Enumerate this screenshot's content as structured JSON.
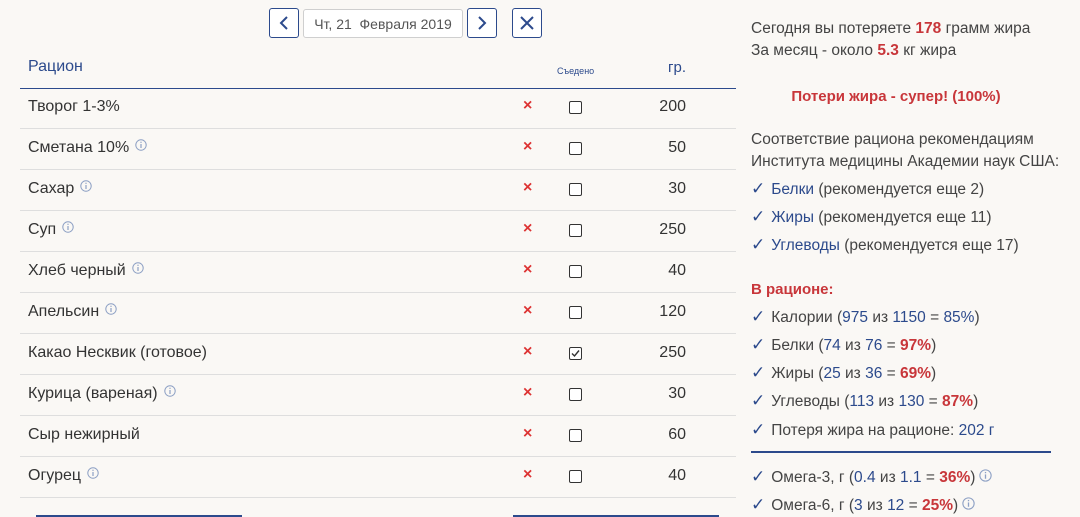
{
  "nav": {
    "date_text": "Чт, 21  Февраля 2019"
  },
  "table": {
    "col_name": "Рацион",
    "col_eaten": "Съедено",
    "col_grams": "гр.",
    "rows": [
      {
        "name": "Творог 1-3%",
        "info": false,
        "eaten": false,
        "grams": "200"
      },
      {
        "name": "Сметана 10%",
        "info": true,
        "eaten": false,
        "grams": "50"
      },
      {
        "name": "Сахар",
        "info": true,
        "eaten": false,
        "grams": "30"
      },
      {
        "name": "Суп",
        "info": true,
        "eaten": false,
        "grams": "250"
      },
      {
        "name": "Хлеб черный",
        "info": true,
        "eaten": false,
        "grams": "40"
      },
      {
        "name": "Апельсин",
        "info": true,
        "eaten": false,
        "grams": "120"
      },
      {
        "name": "Какао Несквик (готовое)",
        "info": false,
        "eaten": true,
        "grams": "250"
      },
      {
        "name": "Курица (вареная)",
        "info": true,
        "eaten": false,
        "grams": "30"
      },
      {
        "name": "Сыр нежирный",
        "info": false,
        "eaten": false,
        "grams": "60"
      },
      {
        "name": "Огурец",
        "info": true,
        "eaten": false,
        "grams": "40"
      }
    ]
  },
  "summary": {
    "today_prefix": "Сегодня вы потеряете ",
    "today_value": "178",
    "today_suffix": " грамм жира",
    "month_prefix": "За месяц - около ",
    "month_value": "5.3",
    "month_suffix": " кг жира",
    "loss_status": "Потери жира - супер! (100%)",
    "compliance_line1": "Соответствие рациона рекомендациям",
    "compliance_line2": "Института медицины Академии наук США:",
    "recommendations": [
      {
        "name": "Белки",
        "text": " (рекомендуется еще 2)"
      },
      {
        "name": "Жиры",
        "text": " (рекомендуется еще 11)"
      },
      {
        "name": "Углеводы",
        "text": " (рекомендуется еще 17)"
      }
    ],
    "in_diet_title": "В рационе:",
    "in_diet": [
      {
        "label": "Калории (",
        "a": "975",
        "mid": " из ",
        "b": "1150",
        "eq": " = ",
        "pct": "85%",
        "end": ")",
        "pct_red": false
      },
      {
        "label": "Белки (",
        "a": "74",
        "mid": " из ",
        "b": "76",
        "eq": " = ",
        "pct": "97%",
        "end": ")",
        "pct_red": true
      },
      {
        "label": "Жиры (",
        "a": "25",
        "mid": " из ",
        "b": "36",
        "eq": " = ",
        "pct": "69%",
        "end": ")",
        "pct_red": true
      },
      {
        "label": "Углеводы (",
        "a": "113",
        "mid": " из ",
        "b": "130",
        "eq": " = ",
        "pct": "87%",
        "end": ")",
        "pct_red": true
      }
    ],
    "fat_loss_label": "Потеря жира на рационе: ",
    "fat_loss_value": "202 г",
    "omega": [
      {
        "label": "Омега-3, г (",
        "a": "0.4",
        "mid": " из ",
        "b": "1.1",
        "eq": " = ",
        "pct": "36%",
        "end": ")"
      },
      {
        "label": "Омега-6, г (",
        "a": "3",
        "mid": " из ",
        "b": "12",
        "eq": " = ",
        "pct": "25%",
        "end": ")"
      }
    ],
    "check_glyph": "✓"
  }
}
